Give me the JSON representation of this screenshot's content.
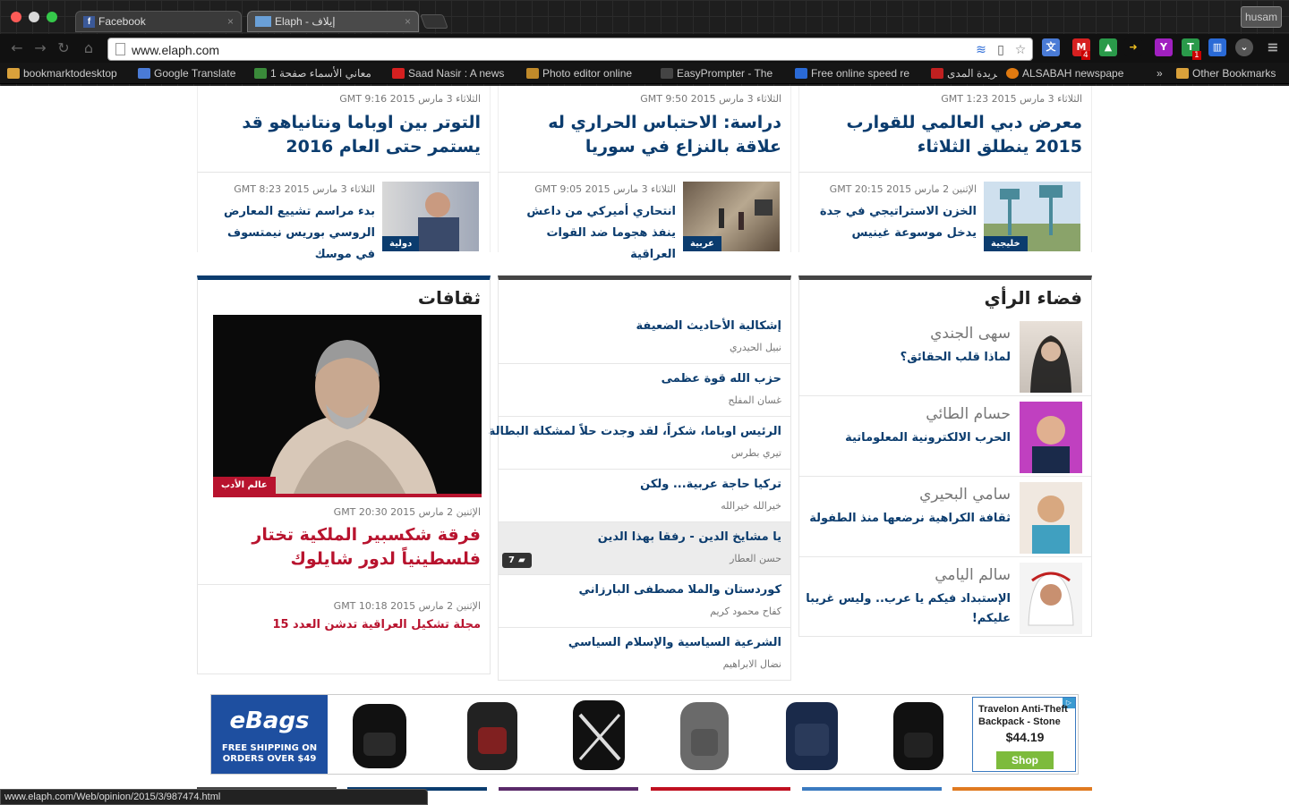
{
  "browser": {
    "tabs": [
      {
        "label": "Facebook"
      },
      {
        "label": "Elaph - إيلاف"
      }
    ],
    "profile": "husam",
    "url": "www.elaph.com",
    "ext_badges": {
      "gmail": "4",
      "tumblr": "1"
    },
    "bookmarks": [
      {
        "label": "bookmarktodesktop",
        "color": "#d9a13b"
      },
      {
        "label": "Google Translate",
        "color": "#4a7bd6"
      },
      {
        "label": "معاني الأسماء صفحة 1",
        "color": "#3a8a3a"
      },
      {
        "label": "Saad Nasir : A news",
        "color": "#d62020"
      },
      {
        "label": "Photo editor online",
        "color": "#c08a2a"
      },
      {
        "label": "EasyPrompter - The",
        "color": "#444444"
      },
      {
        "label": "Free online speed re",
        "color": "#2a6ad6"
      },
      {
        "label": "جريدة المدى",
        "color": "#c02020"
      },
      {
        "label": "ALSABAH newspape",
        "color": "#e07a10"
      }
    ],
    "bookmarks_more": "»",
    "other_bookmarks": "Other Bookmarks",
    "status_url": "www.elaph.com/Web/opinion/2015/3/987474.html"
  },
  "top_news": [
    {
      "meta": "الثلاثاء 3 مارس 2015 GMT 1:23",
      "headline": "معرض دبي العالمي للقوارب 2015 ينطلق الثلاثاء"
    },
    {
      "meta": "الثلاثاء 3 مارس 2015 GMT 9:50",
      "headline": "دراسة: الاحتباس الحراري له علاقة بالنزاع في سوريا"
    },
    {
      "meta": "الثلاثاء 3 مارس 2015 GMT 9:16",
      "headline": "التوتر بين اوباما ونتانياهو قد يستمر حتى العام 2016"
    }
  ],
  "small_news": [
    {
      "meta": "الإثنين 2 مارس 2015 GMT 20:15",
      "title": "الخزن الاستراتيجي في جدة يدخل موسوعة غينيس",
      "badge": "خليجية"
    },
    {
      "meta": "الثلاثاء 3 مارس 2015 GMT 9:05",
      "title": "انتحاري أميركي من داعش ينفذ هجوما ضد القوات العراقية",
      "badge": "عربية"
    },
    {
      "meta": "الثلاثاء 3 مارس 2015 GMT 8:23",
      "title": "بدء مراسم تشييع المعارض الروسي بوريس نيمتسوف في موسك",
      "badge": "دولية"
    }
  ],
  "opinion": {
    "title": "فضاء الرأي",
    "items": [
      {
        "name": "سهى الجندي",
        "title": "لماذا قلب الحقائق؟"
      },
      {
        "name": "حسام الطائي",
        "title": "الحرب الالكترونية المعلوماتية"
      },
      {
        "name": "سامي البحيري",
        "title": "ثقافة الكراهية نرضعها منذ الطفولة"
      },
      {
        "name": "سالم اليامي",
        "title": "الإستبداد فيكم يا عرب.. وليس غريبا عليكم!"
      }
    ]
  },
  "articles": [
    {
      "title": "إشكالية الأحاديث الضعيفة",
      "author": "نبيل الحيدري"
    },
    {
      "title": "حزب الله قوة عظمى",
      "author": "غسان المفلح"
    },
    {
      "title": "الرئيس اوباما، شكراً، لقد وجدت حلاً لمشكلة البطالة",
      "author": "تيري بطرس"
    },
    {
      "title": "تركيا حاجة عربية... ولكن",
      "author": "خيرالله خيرالله"
    },
    {
      "title": "يا مشايخ الدين - رفقا بهذا الدين",
      "author": "حسن العطار",
      "comments": "7"
    },
    {
      "title": "كوردستان والملا مصطفى البارزاني",
      "author": "كفاح محمود كريم"
    },
    {
      "title": "الشرعية السياسية والإسلام السياسي",
      "author": "نضال الابراهيم"
    }
  ],
  "culture": {
    "title": "ثقافات",
    "badge": "عالم الأدب",
    "meta": "الإثنين 2 مارس 2015 GMT 20:30",
    "headline": "فرقة شكسبير الملكية تختار فلسطينياً لدور شايلوك",
    "second_meta": "الإثنين 2 مارس 2015 GMT 10:18",
    "second_title": "مجلة تشكيل العراقية تدشن العدد 15"
  },
  "ad": {
    "brand": "eBags",
    "shipping": "FREE SHIPPING ON ORDERS OVER $49",
    "product": "Travelon Anti-Theft Backpack - Stone -...",
    "price": "$44.19",
    "cta": "Shop"
  },
  "colors": {
    "navy": "#0b3c6e",
    "red": "#b8132e",
    "ebags": "#1e4fa0",
    "shop_green": "#7dbb3c"
  }
}
